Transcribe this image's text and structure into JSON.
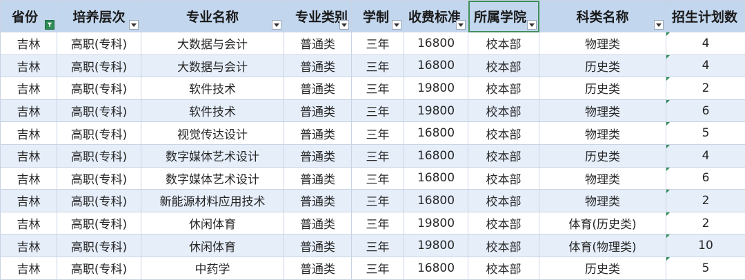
{
  "headers": [
    {
      "label": "省份",
      "filter_active": true
    },
    {
      "label": "培养层次",
      "filter_active": false
    },
    {
      "label": "专业名称",
      "filter_active": false
    },
    {
      "label": "专业类别",
      "filter_active": false
    },
    {
      "label": "学制",
      "filter_active": false
    },
    {
      "label": "收费标准",
      "filter_active": false
    },
    {
      "label": "所属学院",
      "filter_active": false
    },
    {
      "label": "科类名称",
      "filter_active": false
    },
    {
      "label": "招生计划数",
      "filter_active": false
    }
  ],
  "rows": [
    [
      "吉林",
      "高职(专科)",
      "大数据与会计",
      "普通类",
      "三年",
      "16800",
      "校本部",
      "物理类",
      "4"
    ],
    [
      "吉林",
      "高职(专科)",
      "大数据与会计",
      "普通类",
      "三年",
      "16800",
      "校本部",
      "历史类",
      "4"
    ],
    [
      "吉林",
      "高职(专科)",
      "软件技术",
      "普通类",
      "三年",
      "19800",
      "校本部",
      "历史类",
      "2"
    ],
    [
      "吉林",
      "高职(专科)",
      "软件技术",
      "普通类",
      "三年",
      "19800",
      "校本部",
      "物理类",
      "6"
    ],
    [
      "吉林",
      "高职(专科)",
      "视觉传达设计",
      "普通类",
      "三年",
      "16800",
      "校本部",
      "物理类",
      "5"
    ],
    [
      "吉林",
      "高职(专科)",
      "数字媒体艺术设计",
      "普通类",
      "三年",
      "16800",
      "校本部",
      "历史类",
      "4"
    ],
    [
      "吉林",
      "高职(专科)",
      "数字媒体艺术设计",
      "普通类",
      "三年",
      "16800",
      "校本部",
      "物理类",
      "6"
    ],
    [
      "吉林",
      "高职(专科)",
      "新能源材料应用技术",
      "普通类",
      "三年",
      "16800",
      "校本部",
      "物理类",
      "2"
    ],
    [
      "吉林",
      "高职(专科)",
      "休闲体育",
      "普通类",
      "三年",
      "19800",
      "校本部",
      "体育(历史类)",
      "2"
    ],
    [
      "吉林",
      "高职(专科)",
      "休闲体育",
      "普通类",
      "三年",
      "19800",
      "校本部",
      "体育(物理类)",
      "10"
    ],
    [
      "吉林",
      "高职(专科)",
      "中药学",
      "普通类",
      "三年",
      "16800",
      "校本部",
      "历史类",
      "5"
    ]
  ],
  "colors": {
    "header_bg": "#c2d6ee",
    "band_bg": "#e6eefa",
    "filter_active": "#2e8b57"
  }
}
